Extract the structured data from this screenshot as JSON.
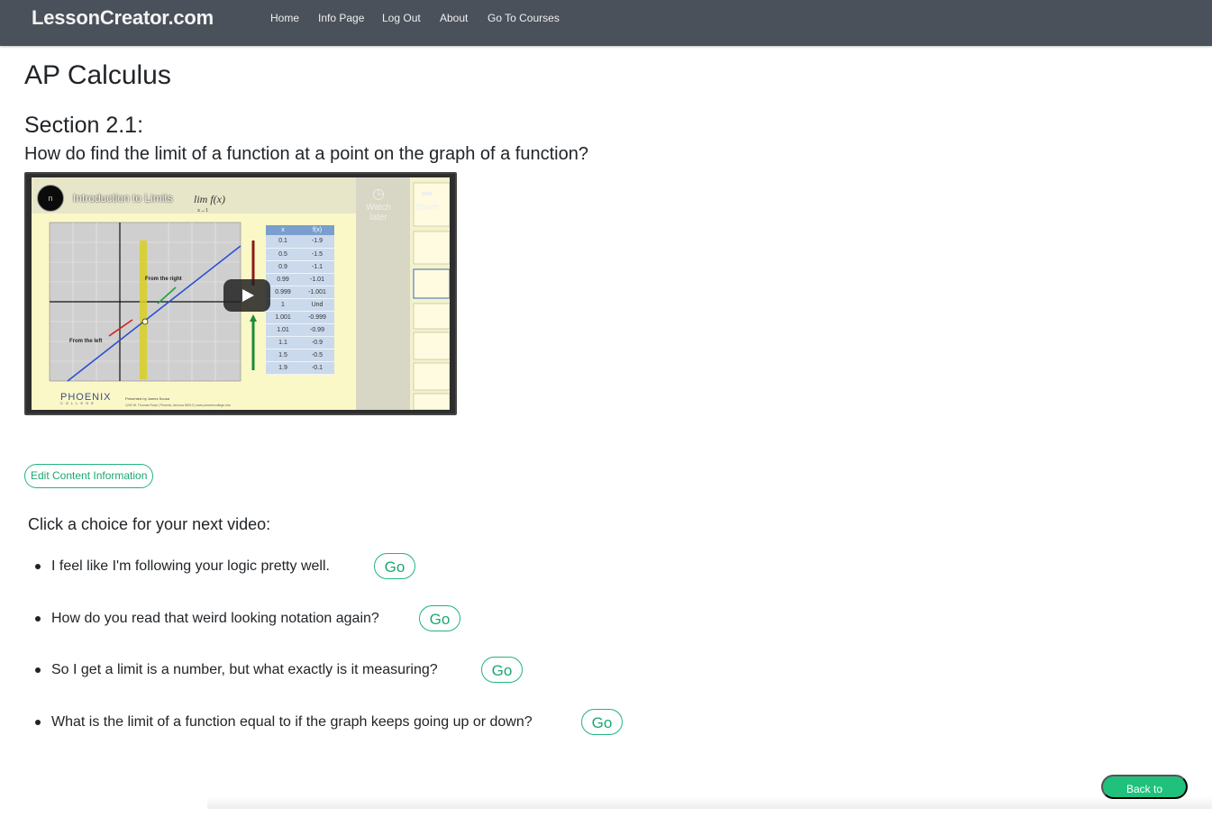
{
  "navbar": {
    "brand": "LessonCreator.com",
    "links": [
      {
        "label": "Home"
      },
      {
        "label": "Info Page"
      },
      {
        "label": "Log Out"
      },
      {
        "label": "About"
      },
      {
        "label": "Go To Courses"
      }
    ]
  },
  "course": {
    "title": "AP Calculus",
    "section": "Section 2.1:",
    "question": "How do find the limit of a function at a point on the graph of a function?"
  },
  "video": {
    "title": "Introduction to Limits",
    "channel_avatar_text": "n",
    "watch_later_label": "Watch later",
    "share_label": "Share",
    "table_headers": [
      "x",
      "f(x)"
    ],
    "table_rows": [
      [
        "0.1",
        "-1.9"
      ],
      [
        "0.5",
        "-1.5"
      ],
      [
        "0.9",
        "-1.1"
      ],
      [
        "0.99",
        "-1.01"
      ],
      [
        "0.999",
        "-1.001"
      ],
      [
        "1",
        "Und"
      ],
      [
        "1.001",
        "-0.999"
      ],
      [
        "1.01",
        "-0.99"
      ],
      [
        "1.1",
        "-0.9"
      ],
      [
        "1.5",
        "-0.5"
      ],
      [
        "1.9",
        "-0.1"
      ]
    ],
    "graph_labels": {
      "from_right": "From the right",
      "from_left": "From the left"
    },
    "logo": {
      "name": "PHOENIX",
      "sub": "COLLEGE"
    }
  },
  "edit_button_label": "Edit Content Information",
  "choices": {
    "prompt": "Click a choice for your next video:",
    "items": [
      {
        "label": "I feel like I'm following your logic pretty well.",
        "button": "Go"
      },
      {
        "label": "How do you read that weird looking notation again?",
        "button": "Go"
      },
      {
        "label": "So I get a limit is a number, but what exactly is it measuring?",
        "button": "Go"
      },
      {
        "label": "What is the limit of a function equal to if the graph keeps going up or down?",
        "button": "Go"
      }
    ]
  },
  "back_button_label": "Back to Lessons",
  "colors": {
    "navbar": "#4a515b",
    "accent": "#1fc17c",
    "outline_button": "#24b47e"
  }
}
